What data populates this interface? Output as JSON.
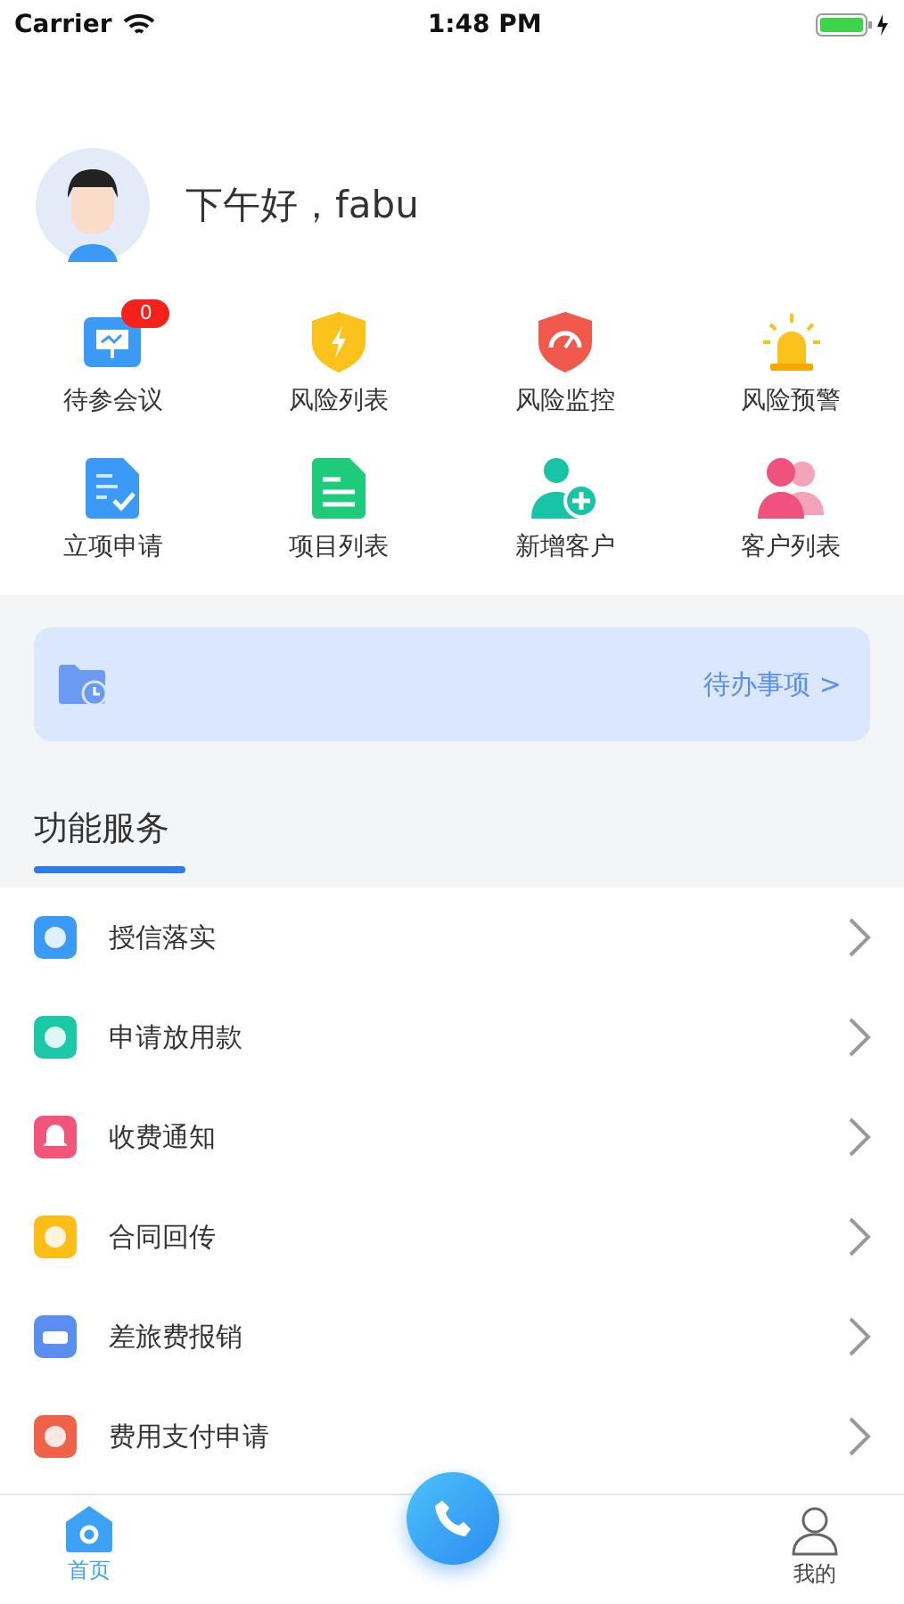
{
  "status_bar": {
    "carrier": "Carrier",
    "time": "1:48 PM"
  },
  "greeting": "下午好，fabu",
  "shortcuts": [
    {
      "label": "待参会议",
      "badge": "0"
    },
    {
      "label": "风险列表"
    },
    {
      "label": "风险监控"
    },
    {
      "label": "风险预警"
    },
    {
      "label": "立项申请"
    },
    {
      "label": "项目列表"
    },
    {
      "label": "新增客户"
    },
    {
      "label": "客户列表"
    }
  ],
  "todo_banner": {
    "label": "待办事项 >"
  },
  "section_title": "功能服务",
  "services": [
    {
      "label": "授信落实"
    },
    {
      "label": "申请放用款"
    },
    {
      "label": "收费通知"
    },
    {
      "label": "合同回传"
    },
    {
      "label": "差旅费报销"
    },
    {
      "label": "费用支付申请"
    }
  ],
  "tab_bar": [
    {
      "label": "首页",
      "selected": true
    },
    {
      "label": "我的",
      "selected": false
    }
  ]
}
